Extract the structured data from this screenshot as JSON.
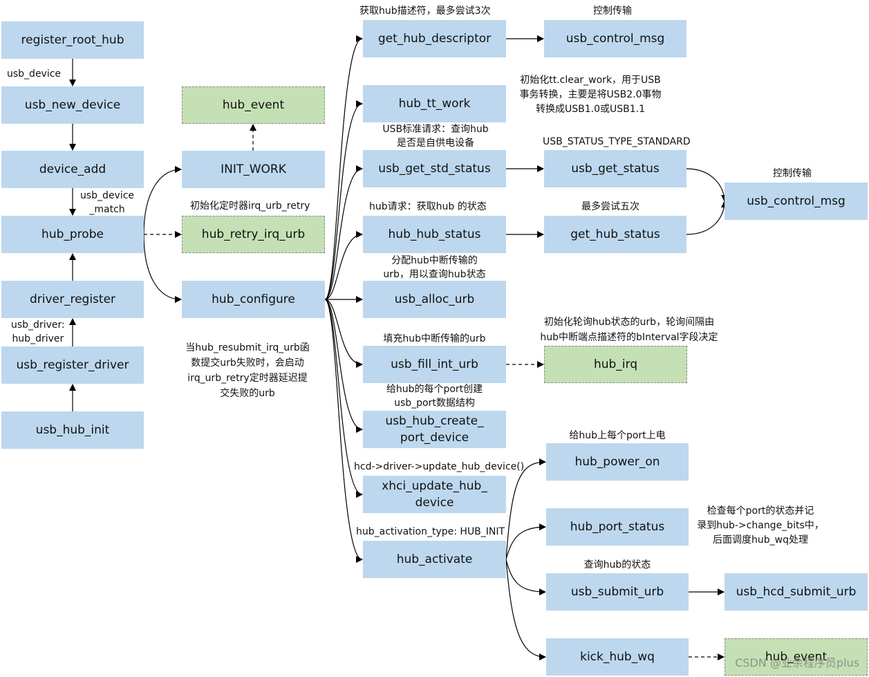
{
  "boxes": {
    "register_root_hub": "register_root_hub",
    "usb_new_device": "usb_new_device",
    "device_add": "device_add",
    "hub_probe": "hub_probe",
    "driver_register": "driver_register",
    "usb_register_driver": "usb_register_driver",
    "usb_hub_init": "usb_hub_init",
    "hub_event_top": "hub_event",
    "init_work": "INIT_WORK",
    "hub_retry_irq_urb": "hub_retry_irq_urb",
    "hub_configure": "hub_configure",
    "get_hub_descriptor": "get_hub_descriptor",
    "hub_tt_work": "hub_tt_work",
    "usb_get_std_status": "usb_get_std_status",
    "hub_hub_status": "hub_hub_status",
    "usb_alloc_urb": "usb_alloc_urb",
    "usb_fill_int_urb": "usb_fill_int_urb",
    "usb_hub_create_port_device": "usb_hub_create_\nport_device",
    "xhci_update_hub_device": "xhci_update_hub_\ndevice",
    "hub_activate": "hub_activate",
    "usb_control_msg_1": "usb_control_msg",
    "usb_get_status": "usb_get_status",
    "get_hub_status": "get_hub_status",
    "hub_irq": "hub_irq",
    "hub_power_on": "hub_power_on",
    "hub_port_status": "hub_port_status",
    "usb_submit_urb": "usb_submit_urb",
    "kick_hub_wq": "kick_hub_wq",
    "usb_control_msg_2": "usb_control_msg",
    "usb_hcd_submit_urb": "usb_hcd_submit_urb",
    "hub_event_bottom": "hub_event"
  },
  "labels": {
    "usb_device": "usb_device",
    "usb_device_match": "usb_device\n_match",
    "usb_driver_hub_driver": "usb_driver:\nhub_driver",
    "init_timer": "初始化定时器irq_urb_retry",
    "resubmit_note": "当hub_resubmit_irq_urb函\n数提交urb失败时，会启动\nirq_urb_retry定时器延迟提\n交失败的urb",
    "get_descriptor_note": "获取hub描述符，最多尝试3次",
    "control_transfer_1": "控制传输",
    "tt_note": "初始化tt.clear_work，用于USB\n事务转换，主要是将USB2.0事物\n转换成USB1.0或USB1.1",
    "std_request_note": "USB标准请求：查询hub\n是否是自供电设备",
    "status_type": "USB_STATUS_TYPE_STANDARD",
    "control_transfer_2": "控制传输",
    "hub_request_note": "hub请求：获取hub 的状态",
    "max_five": "最多尝试五次",
    "alloc_note": "分配hub中断传输的\nurb，用以查询hub状态",
    "fill_note": "填充hub中断传输的urb",
    "irq_note": "初始化轮询hub状态的urb，轮询间隔由\nhub中断端点描述符的bInterval字段决定",
    "create_port_note": "给hub的每个port创建\nusb_port数据结构",
    "update_note": "hcd->driver->update_hub_device()",
    "power_note": "给hub上每个port上电",
    "activation_type": "hub_activation_type: HUB_INIT",
    "port_status_note": "检查每个port的状态并记\n录到hub->change_bits中，\n后面调度hub_wq处理",
    "query_status_note": "查询hub的状态"
  },
  "watermark": "CSDN @业余程序员plus",
  "colors": {
    "box": "#bdd7ee",
    "async_box": "#c5e0b4"
  }
}
